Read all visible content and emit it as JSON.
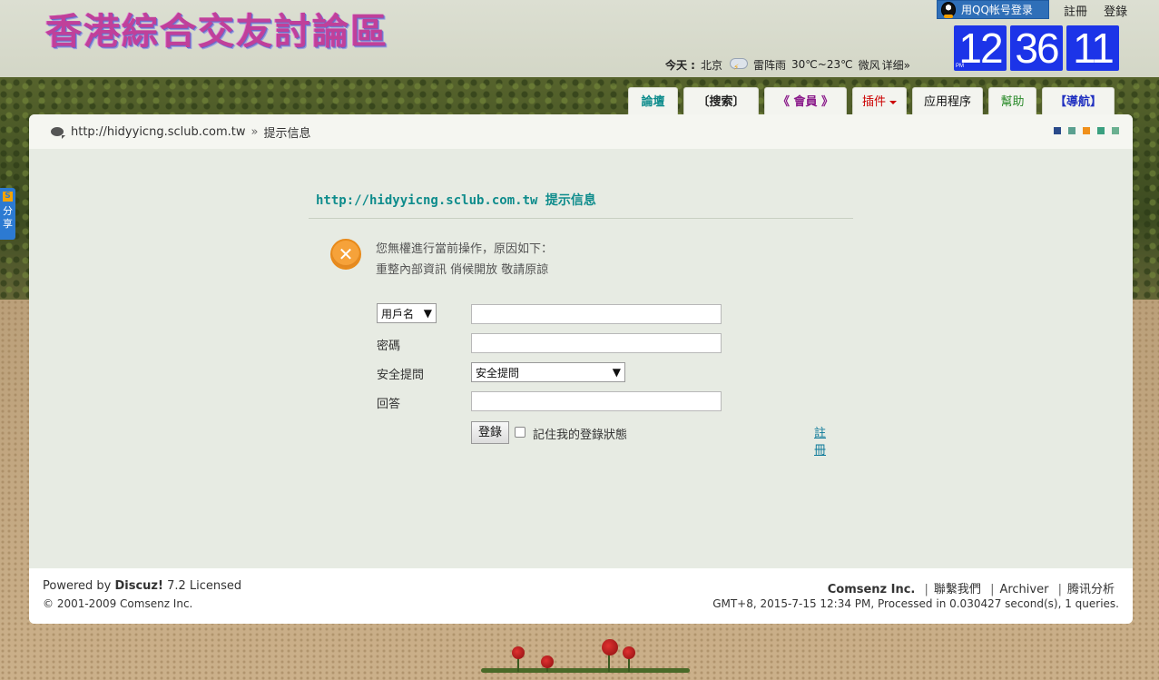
{
  "header": {
    "logo_text": "香港綜合交友討論區",
    "qq_login_label": "用QQ帐号登录",
    "register_link": "註冊",
    "login_link": "登錄",
    "clock": {
      "hour": "12",
      "minute": "36",
      "second": "11",
      "ampm": "PM"
    },
    "weather": {
      "today_label": "今天 :",
      "city": "北京",
      "condition": "雷阵雨",
      "temp": "30℃~23℃",
      "wind": "微风",
      "detail_link": "详细»"
    }
  },
  "nav": {
    "tabs": [
      {
        "label": "論壇"
      },
      {
        "label": "〔搜索〕"
      },
      {
        "label": "《 會員 》"
      },
      {
        "label": "插件"
      },
      {
        "label": "应用程序"
      },
      {
        "label": "幫助"
      },
      {
        "label": "【導航】"
      }
    ]
  },
  "breadcrumb": {
    "site": "http://hidyyicng.sclub.com.tw",
    "separator": "»",
    "current": "提示信息"
  },
  "style_dots": [
    "#2a4a8a",
    "#5aa090",
    "#f0901a",
    "#3aa080",
    "#6ab090"
  ],
  "message": {
    "title_site": "http://hidyyicng.sclub.com.tw",
    "title_tip": "提示信息",
    "line1": "您無權進行當前操作，原因如下：",
    "line2": "重整內部資訊 俏候開放 敬請原諒"
  },
  "login_form": {
    "username_select": "用戶名",
    "password_label": "密碼",
    "question_label": "安全提問",
    "question_select": "安全提問",
    "answer_label": "回答",
    "submit_label": "登錄",
    "remember_label": "記住我的登錄狀態",
    "register_link": "註冊"
  },
  "footer": {
    "powered_prefix": "Powered by ",
    "powered_product": "Discuz!",
    "powered_version": " 7.2 Licensed",
    "copyright": "© 2001-2009 Comsenz Inc.",
    "company": "Comsenz Inc.",
    "contact": "聯繫我們",
    "archiver": "Archiver",
    "analytics": "腾讯分析",
    "status": "GMT+8, 2015-7-15 12:34 PM, Processed in 0.030427 second(s), 1 queries."
  },
  "share": {
    "label": "分享"
  }
}
